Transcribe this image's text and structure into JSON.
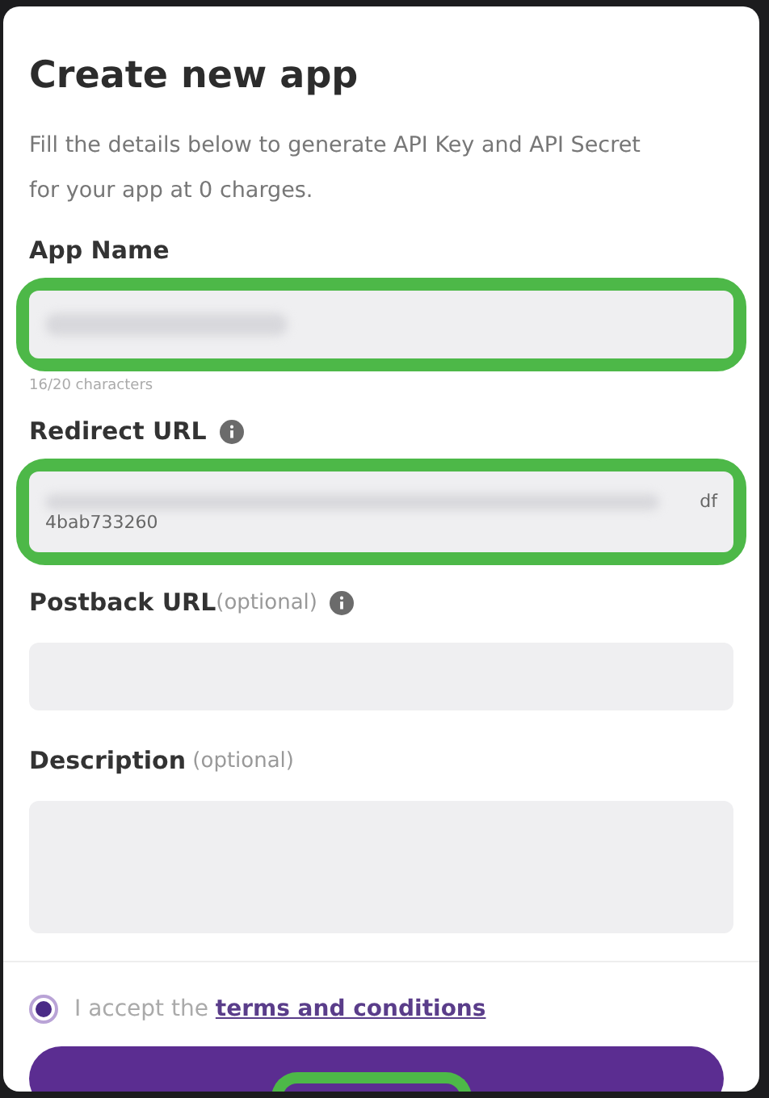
{
  "dialog": {
    "title": "Create new app",
    "intro": "Fill the details below to generate API Key and API Secret for your app at 0 charges."
  },
  "fields": [
    {
      "kind": "input",
      "label": "App Name",
      "info": false,
      "highlighted": true,
      "counter": "16/20 characters"
    },
    {
      "kind": "url",
      "label": "Redirect URL",
      "info": true,
      "highlighted": true,
      "value_end": "df",
      "value_line2": "4bab733260"
    },
    {
      "kind": "input",
      "label": "Postback URL",
      "hint": "(optional)",
      "info": true,
      "highlighted": false
    },
    {
      "kind": "textarea",
      "label": "Description",
      "hint": " (optional)",
      "info": false,
      "highlighted": false
    }
  ],
  "terms": {
    "checked": true,
    "text": "I accept the ",
    "link": "terms and conditions"
  },
  "submit": {
    "highlighted": true
  }
}
